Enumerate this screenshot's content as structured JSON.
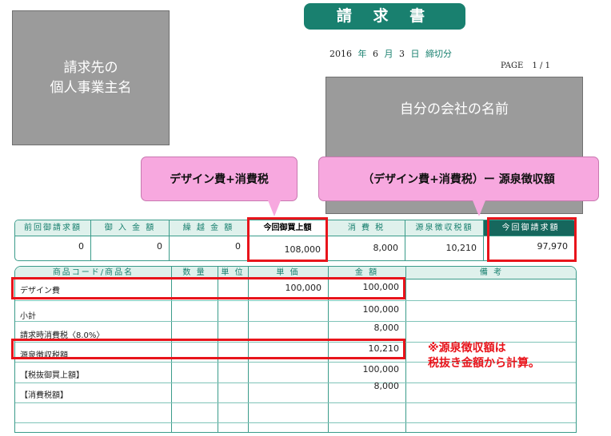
{
  "title": "請 求 書",
  "client_box": "請求先の\n個人事業主名",
  "company_box": "自分の会社の名前",
  "date": {
    "year": "2016",
    "year_label": "年",
    "month": "6",
    "month_label": "月",
    "day": "3",
    "day_label": "日",
    "closing": "締切分"
  },
  "page": {
    "label": "PAGE",
    "value": "1 / 1"
  },
  "callouts": {
    "design": "デザイン費+消費税",
    "net": "（デザイン費+消費税）ー 源泉徴収額"
  },
  "summary": {
    "columns": [
      {
        "label": "前回御請求額",
        "value": "0"
      },
      {
        "label": "御 入 金 額",
        "value": "0"
      },
      {
        "label": "繰 越 金 額",
        "value": "0"
      },
      {
        "label": "今回御買上額",
        "value": "108,000"
      },
      {
        "label": "消 費 税",
        "value": "8,000"
      },
      {
        "label": "源泉徴収税額",
        "value": "10,210"
      },
      {
        "label": "今回御請求額",
        "value": "97,970"
      }
    ]
  },
  "items": {
    "headers": [
      "商品コード/商品名",
      "数 量",
      "単 位",
      "単 価",
      "金 額",
      "備 考"
    ],
    "rows": [
      {
        "name": "デザイン費",
        "unit_price": "100,000",
        "amount": "100,000"
      },
      {
        "name": "小計",
        "unit_price": "",
        "amount": "100,000"
      },
      {
        "name": "請求時消費税〈8.0%〉",
        "unit_price": "",
        "amount": "8,000"
      },
      {
        "name": "源泉徴収税額",
        "unit_price": "",
        "amount": "10,210"
      },
      {
        "name": "【税抜御買上額】",
        "unit_price": "",
        "amount": "100,000"
      },
      {
        "name": "【消費税額】",
        "unit_price": "",
        "amount": "8,000"
      }
    ]
  },
  "note": "※源泉徴収額は\n税抜き金額から計算。",
  "colors": {
    "teal": "#19806f",
    "dark_teal": "#16675d",
    "header_bg": "#dff1ec",
    "highlight_red": "#e8141b",
    "callout_pink": "#f7a8df",
    "overlay_gray": "#9b9b9b"
  }
}
